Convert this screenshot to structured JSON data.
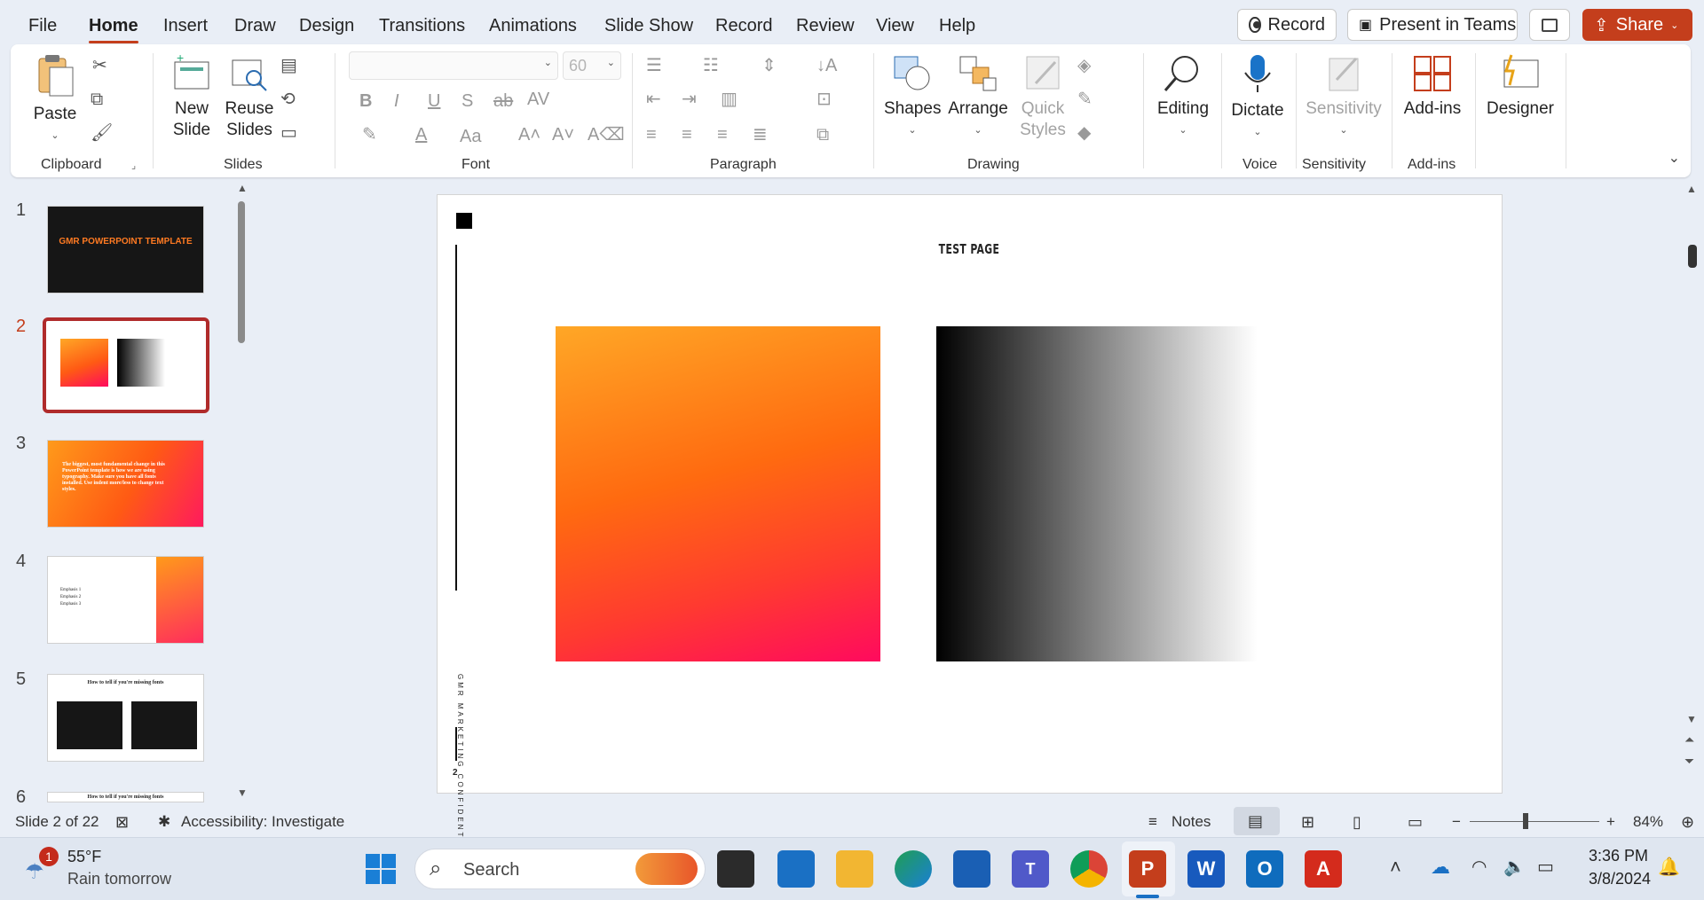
{
  "menu": {
    "tabs": [
      "File",
      "Home",
      "Insert",
      "Draw",
      "Design",
      "Transitions",
      "Animations",
      "Slide Show",
      "Record",
      "Review",
      "View",
      "Help"
    ],
    "active": "Home"
  },
  "titlebar": {
    "record": "Record",
    "present": "Present in Teams",
    "share": "Share"
  },
  "ribbon": {
    "clipboard": {
      "label": "Clipboard",
      "paste": "Paste"
    },
    "slides": {
      "label": "Slides",
      "new_slide": "New Slide",
      "new_line1": "New",
      "new_line2": "Slide",
      "reuse_line1": "Reuse",
      "reuse_line2": "Slides"
    },
    "font": {
      "label": "Font",
      "font_name": "",
      "font_size": "60"
    },
    "paragraph": {
      "label": "Paragraph"
    },
    "drawing": {
      "label": "Drawing",
      "shapes": "Shapes",
      "arrange": "Arrange",
      "quick1": "Quick",
      "quick2": "Styles"
    },
    "editing": {
      "label": "Editing"
    },
    "voice": {
      "label": "Voice",
      "dictate": "Dictate"
    },
    "sensitivity": {
      "label": "Sensitivity",
      "button": "Sensitivity"
    },
    "addins": {
      "label": "Add-ins",
      "button": "Add-ins"
    },
    "designer": {
      "button": "Designer"
    }
  },
  "slides_panel": {
    "numbers": [
      "1",
      "2",
      "3",
      "4",
      "5",
      "6"
    ],
    "current": 2,
    "thumb1_title": "GMR POWERPOINT TEMPLATE",
    "thumb3_text": "The biggest, most fundamental change in this PowerPoint template is how we are using typography. Make sure you have all fonts installed. Use indent more/less to change text styles.",
    "thumb4_e1": "Emphasis 1",
    "thumb4_e2": "Emphasis 2",
    "thumb4_e3": "Emphasis 3",
    "thumb5_title": "How to tell if you're missing fonts",
    "thumb6_title": "How to tell if you're missing fonts"
  },
  "slide": {
    "title": "TEST PAGE",
    "side_text": "GMR MARKETING CONFIDENTIAL",
    "page_number": "2",
    "gradient_colors": {
      "orange_start": "#ffa726",
      "orange_mid": "#ff5a14",
      "orange_end": "#ff0a5e",
      "gray_start": "#000000",
      "gray_end": "#ffffff"
    }
  },
  "status": {
    "slide_of": "Slide 2 of 22",
    "accessibility": "Accessibility: Investigate",
    "notes": "Notes",
    "zoom": "84%"
  },
  "taskbar": {
    "weather_temp": "55°F",
    "weather_desc": "Rain tomorrow",
    "weather_badge": "1",
    "search": "Search",
    "time": "3:36 PM",
    "date": "3/8/2024"
  }
}
